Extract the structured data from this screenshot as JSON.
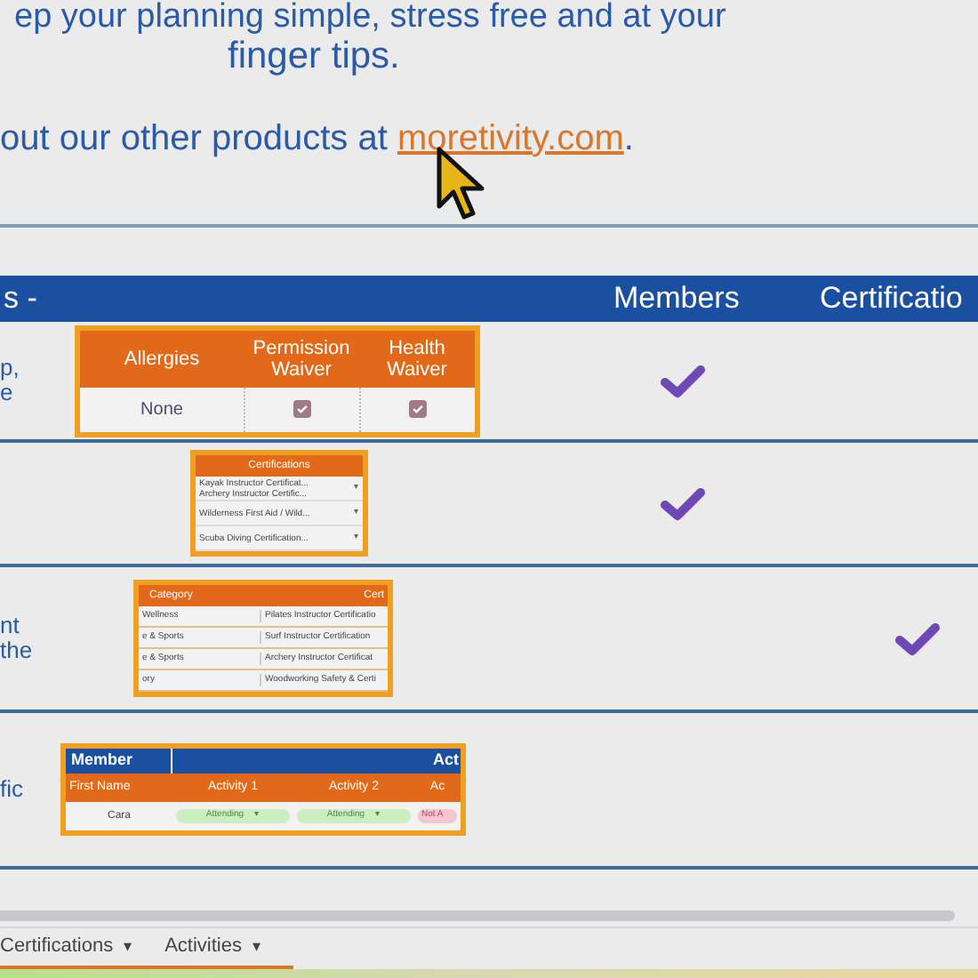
{
  "intro": {
    "line_1": "ep your planning simple, stress free and at your",
    "line_2": "finger tips.",
    "line_3": "out our other products at ",
    "link": "moretivity.com",
    "line_3_end": "."
  },
  "table": {
    "columns": [
      "s -",
      "Members",
      "Certificatio"
    ],
    "rows": [
      {
        "label_lines": [
          "p,",
          "e"
        ],
        "members": true,
        "certifications": false,
        "preview": {
          "kind": "waiver",
          "headers": [
            "Allergies",
            "Permission Waiver",
            "Health Waiver"
          ],
          "cells": [
            {
              "text": "None"
            },
            {
              "checked": true
            },
            {
              "checked": true
            }
          ]
        }
      },
      {
        "label_lines": [],
        "members": true,
        "certifications": false,
        "preview": {
          "kind": "list",
          "header": "Certifications",
          "items": [
            [
              "Kayak Instructor Certificat...",
              "Archery Instructor Certific..."
            ],
            [
              "Wilderness First Aid / Wild..."
            ],
            [
              "Scuba Diving Certification..."
            ]
          ],
          "caret": "▾"
        }
      },
      {
        "label_lines": [
          "nt",
          "the"
        ],
        "members": false,
        "certifications": true,
        "preview": {
          "kind": "grid",
          "headers": [
            "Category",
            "Cert"
          ],
          "rows": [
            [
              "Wellness",
              "Pilates Instructor Certificatio"
            ],
            [
              "e & Sports",
              "Surf Instructor Certification"
            ],
            [
              "e & Sports",
              "Archery Instructor Certificat"
            ],
            [
              "ory",
              "Woodworking Safety & Certi"
            ]
          ]
        }
      },
      {
        "label_lines": [
          "fic"
        ],
        "members": false,
        "certifications": false,
        "preview": {
          "kind": "activity",
          "group_headers": [
            "Member",
            "Act"
          ],
          "headers": [
            "First Name",
            "Activity 1",
            "Activity 2",
            "Ac"
          ],
          "name": "Cara",
          "statuses": [
            {
              "text": "Attending",
              "caret": "▾",
              "color": "#cdeec0"
            },
            {
              "text": "Attending",
              "caret": "▾",
              "color": "#cdeec0"
            },
            {
              "text": "Not A",
              "color": "#f6c6cf"
            }
          ]
        }
      }
    ]
  },
  "sheet_tabs": [
    {
      "label": "Certifications",
      "caret": "▾"
    },
    {
      "label": "Activities",
      "caret": "▾"
    }
  ]
}
